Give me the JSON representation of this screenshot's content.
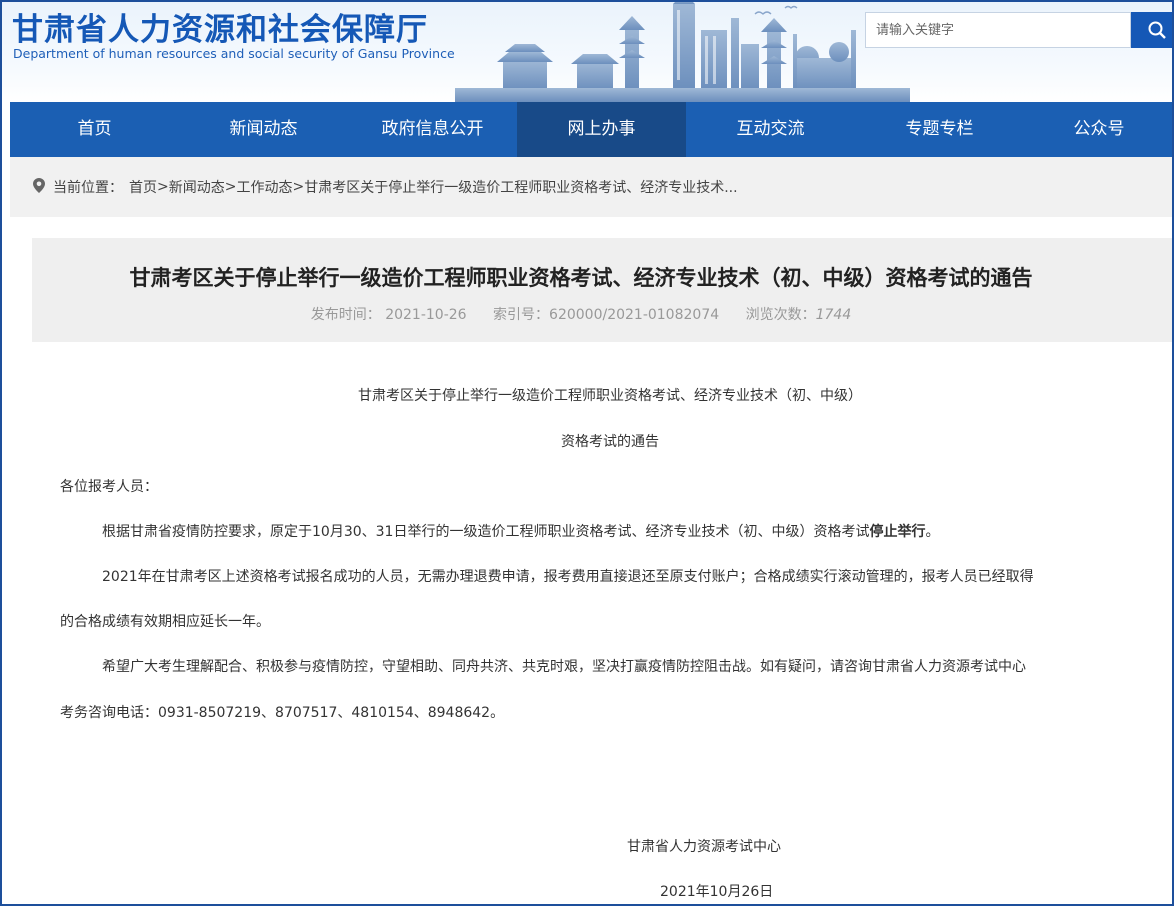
{
  "header": {
    "title": "甘肃省人力资源和社会保障厅",
    "subtitle": "Department of human resources and social security of Gansu Province",
    "search_placeholder": "请输入关键字"
  },
  "nav": {
    "items": [
      "首页",
      "新闻动态",
      "政府信息公开",
      "网上办事",
      "互动交流",
      "专题专栏",
      "公众号"
    ],
    "active": "网上办事"
  },
  "breadcrumb": {
    "label": "当前位置：",
    "items": [
      "首页",
      "新闻动态",
      "工作动态",
      "甘肃考区关于停止举行一级造价工程师职业资格考试、经济专业技术..."
    ],
    "separators": [
      ">",
      ">",
      " >"
    ]
  },
  "article": {
    "title": "甘肃考区关于停止举行一级造价工程师职业资格考试、经济专业技术（初、中级）资格考试的通告",
    "meta": {
      "date_label": "发布时间：",
      "date": "2021-10-26",
      "index_label": "索引号：",
      "index": "620000/2021-01082074",
      "views_label": "浏览次数：",
      "views": "1744"
    },
    "heading_line1": "甘肃考区关于停止举行一级造价工程师职业资格考试、经济专业技术（初、中级）",
    "heading_line2": "资格考试的通告",
    "greeting": "各位报考人员：",
    "p1_main": "根据甘肃省疫情防控要求，原定于10月30、31日举行的一级造价工程师职业资格考试、经济专业技术（初、中级）资格考试",
    "p1_bold": "停止举行",
    "p1_end": "。",
    "p2_line1": "2021年在甘肃考区上述资格考试报名成功的人员，无需办理退费申请，报考费用直接退还至原支付账户；合格成绩实行滚动管理的，报考人员已经取得",
    "p2_line2": "的合格成绩有效期相应延长一年。",
    "p3_line1": "希望广大考生理解配合、积极参与疫情防控，守望相助、同舟共济、共克时艰，坚决打赢疫情防控阻击战。如有疑问，请咨询甘肃省人力资源考试中心",
    "p3_line2": "考务咨询电话：0931-8507219、8707517、4810154、8948642。",
    "signature": "甘肃省人力资源考试中心",
    "sign_date": "2021年10月26日"
  },
  "colors": {
    "brand_blue": "#1b5fb3",
    "nav_active": "#184a88",
    "title_blue": "#1558b6"
  },
  "icons": [
    "search-icon",
    "location-pin-icon",
    "city-skyline-illustration"
  ]
}
